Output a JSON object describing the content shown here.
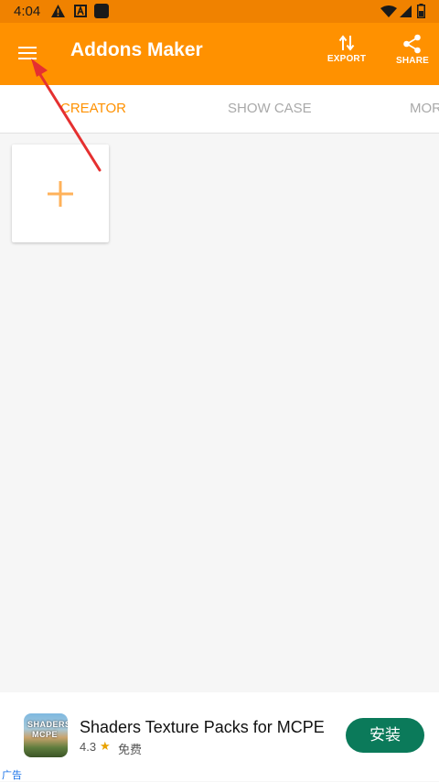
{
  "status_bar": {
    "time": "4:04"
  },
  "app_bar": {
    "title": "Addons Maker",
    "export_label": "EXPORT",
    "share_label": "SHARE"
  },
  "tabs": [
    {
      "label": "CREATOR",
      "active": true
    },
    {
      "label": "SHOW CASE",
      "active": false
    },
    {
      "label": "MOR",
      "active": false
    }
  ],
  "ad": {
    "thumb_line1": "SHADERS",
    "thumb_line2": "MCPE",
    "title": "Shaders Texture Packs for MCPE",
    "rating": "4.3",
    "star": "★",
    "price": "免费",
    "install_label": "安装",
    "ad_label": "广告"
  },
  "colors": {
    "status_bar": "#f08200",
    "primary": "#ff9100",
    "plus": "#ffb25a",
    "install_button": "#0b7a5a",
    "annotation_arrow": "#e53030"
  }
}
